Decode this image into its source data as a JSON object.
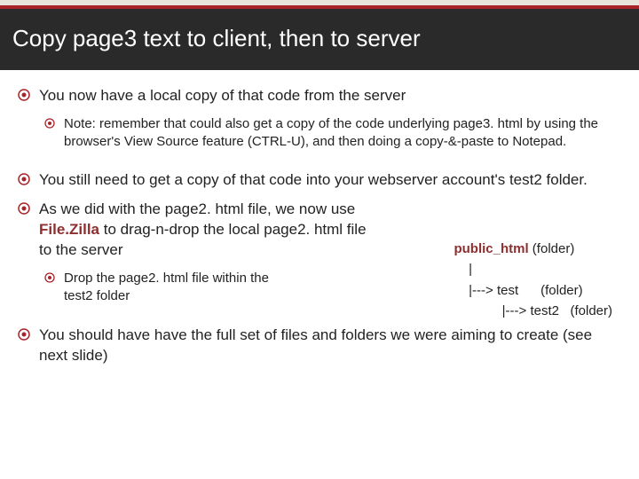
{
  "title": "Copy page3 text to client, then to server",
  "bullets": {
    "b1": "You now have a local copy of that code from the server",
    "b1a": "Note: remember that could also get a copy of the code underlying page3. html by using the browser's View Source feature (CTRL-U), and then doing a copy-&-paste to Notepad.",
    "b2": "You still need to get a copy of that code into your webserver account's test2 folder.",
    "b3_pre": "As we did with the page2. html file, we now use ",
    "b3_bold": "File.Zilla",
    "b3_post": " to drag-n-drop the local page2. html file to the server",
    "b3a": "Drop the page2. html file within the test2 folder",
    "b4": "You should have have the full set of files and folders we were aiming to create (see next slide)"
  },
  "tree": {
    "root_bold": "public_html",
    "root_tail": " (folder)",
    "pipe": "    |",
    "l1_pre": "    |---> test",
    "l1_tail": "      (folder)",
    "l2_pre": "             |---> test2   (folder)"
  }
}
